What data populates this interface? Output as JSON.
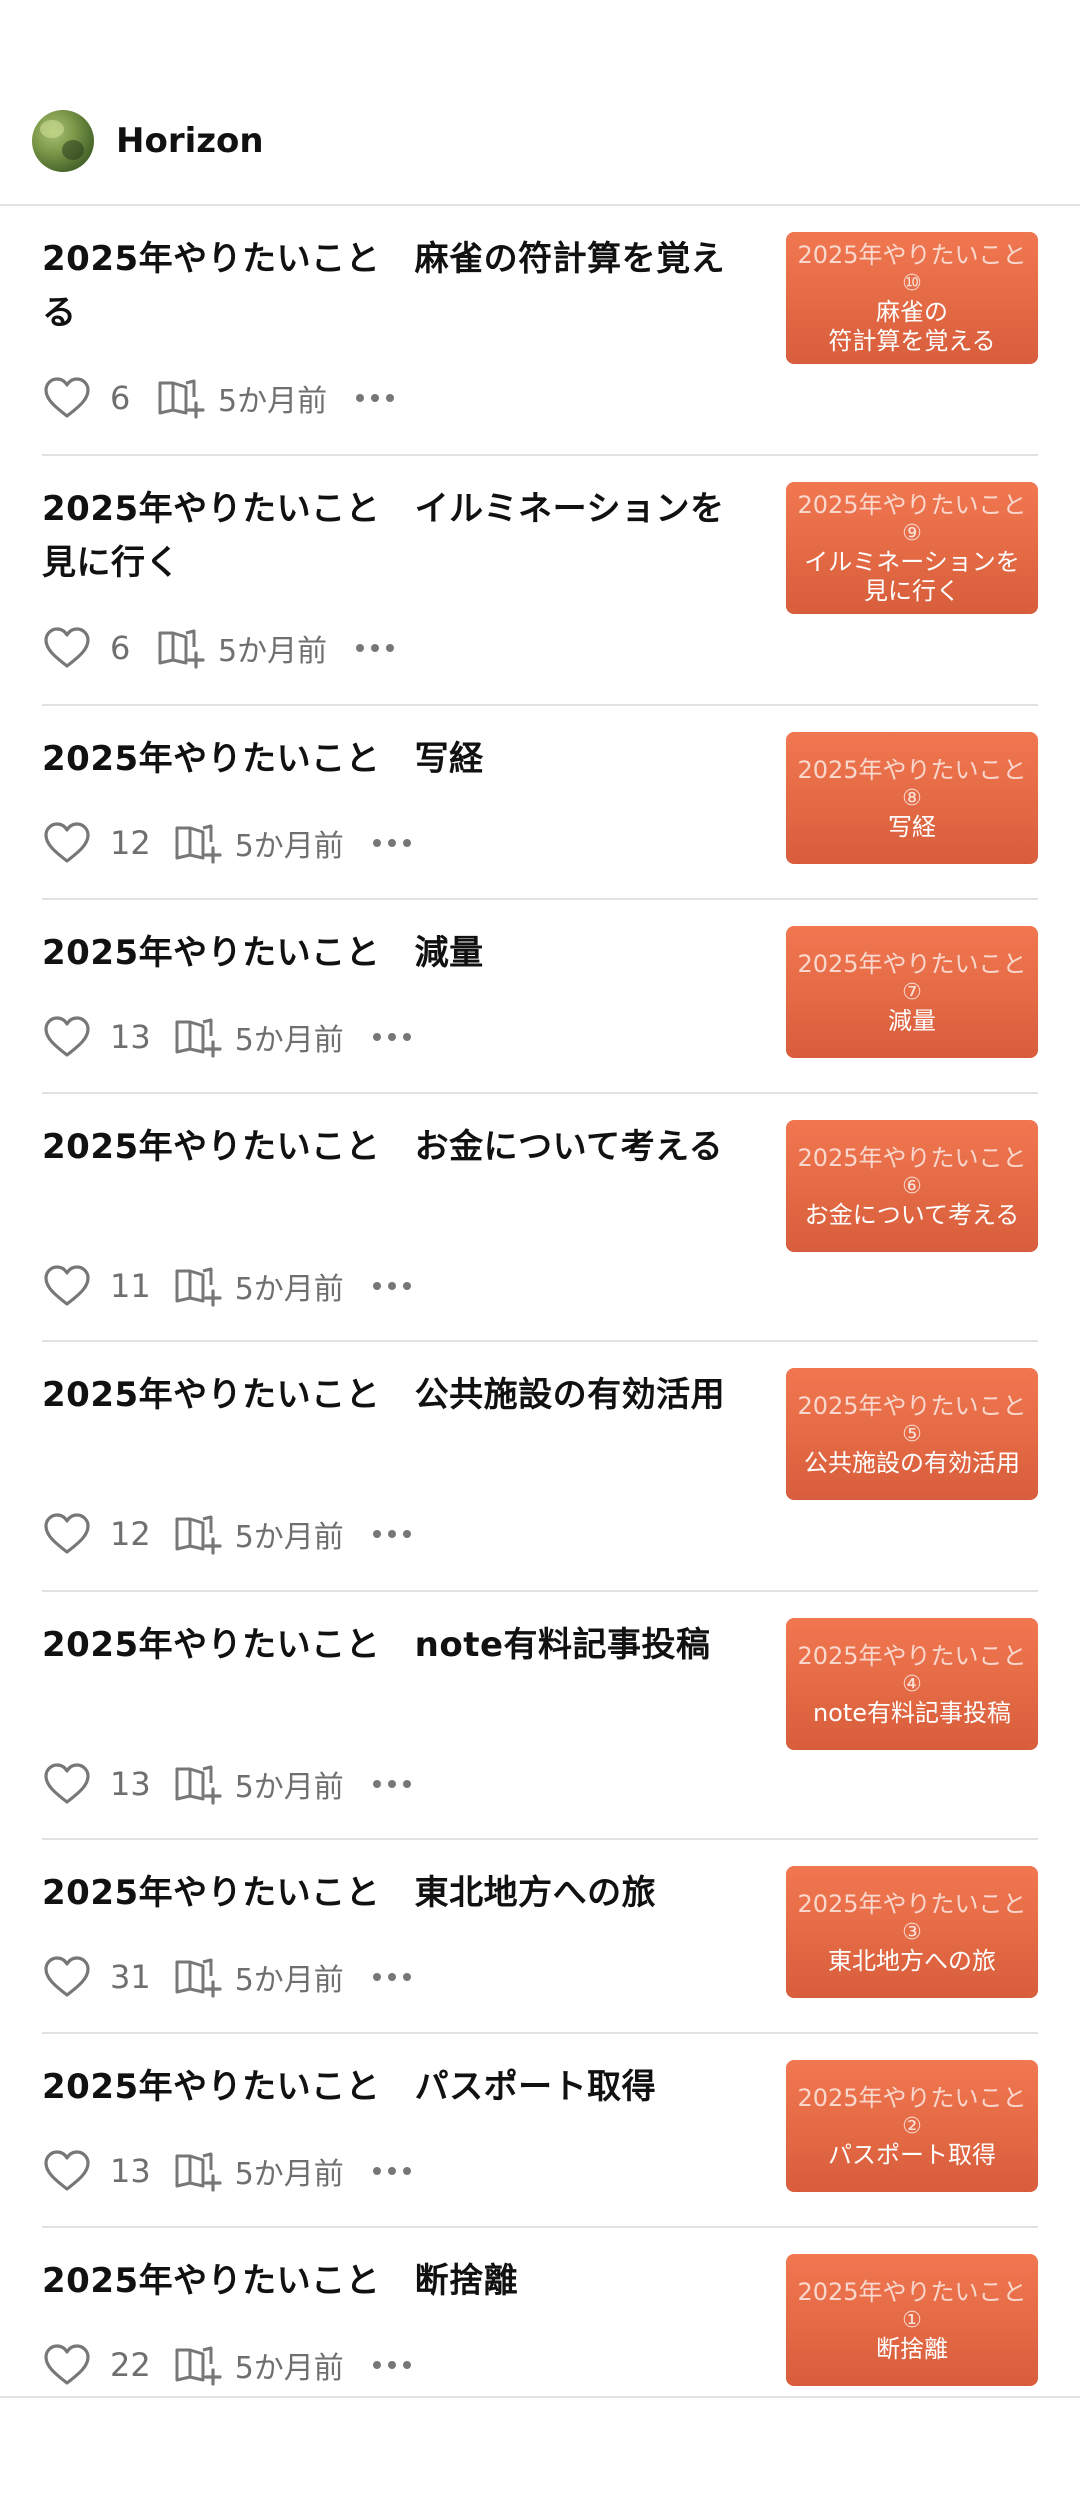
{
  "header": {
    "user_name": "Horizon",
    "avatar_icon": "avatar-tree-photo"
  },
  "icons": {
    "like": "heart-outline-icon",
    "save": "magazine-add-icon",
    "more": "more-horizontal-icon"
  },
  "colors": {
    "thumbnail_bg": "#e8714b",
    "meta_text": "#6f6f6f",
    "divider": "#e2e2e2"
  },
  "articles": [
    {
      "title": "2025年やりたいこと　麻雀の符計算を覚える",
      "likes": "6",
      "date": "5か月前",
      "thumb_top": "2025年やりたいこと",
      "thumb_num": "⑩",
      "thumb_sub": "麻雀の\n符計算を覚える"
    },
    {
      "title": "2025年やりたいこと　イルミネーションを見に行く",
      "likes": "6",
      "date": "5か月前",
      "thumb_top": "2025年やりたいこと",
      "thumb_num": "⑨",
      "thumb_sub": "イルミネーションを\n見に行く"
    },
    {
      "title": "2025年やりたいこと　写経",
      "likes": "12",
      "date": "5か月前",
      "thumb_top": "2025年やりたいこと",
      "thumb_num": "⑧",
      "thumb_sub": "写経"
    },
    {
      "title": "2025年やりたいこと　減量",
      "likes": "13",
      "date": "5か月前",
      "thumb_top": "2025年やりたいこと",
      "thumb_num": "⑦",
      "thumb_sub": "減量"
    },
    {
      "title": "2025年やりたいこと　お金について考える",
      "likes": "11",
      "date": "5か月前",
      "thumb_top": "2025年やりたいこと",
      "thumb_num": "⑥",
      "thumb_sub": "お金について考える"
    },
    {
      "title": "2025年やりたいこと　公共施設の有効活用",
      "likes": "12",
      "date": "5か月前",
      "thumb_top": "2025年やりたいこと",
      "thumb_num": "⑤",
      "thumb_sub": "公共施設の有効活用"
    },
    {
      "title": "2025年やりたいこと　note有料記事投稿",
      "likes": "13",
      "date": "5か月前",
      "thumb_top": "2025年やりたいこと",
      "thumb_num": "④",
      "thumb_sub": "note有料記事投稿"
    },
    {
      "title": "2025年やりたいこと　東北地方への旅",
      "likes": "31",
      "date": "5か月前",
      "thumb_top": "2025年やりたいこと",
      "thumb_num": "③",
      "thumb_sub": "東北地方への旅"
    },
    {
      "title": "2025年やりたいこと　パスポート取得",
      "likes": "13",
      "date": "5か月前",
      "thumb_top": "2025年やりたいこと",
      "thumb_num": "②",
      "thumb_sub": "パスポート取得"
    },
    {
      "title": "2025年やりたいこと　断捨離",
      "likes": "22",
      "date": "5か月前",
      "thumb_top": "2025年やりたいこと",
      "thumb_num": "①",
      "thumb_sub": "断捨離"
    }
  ]
}
